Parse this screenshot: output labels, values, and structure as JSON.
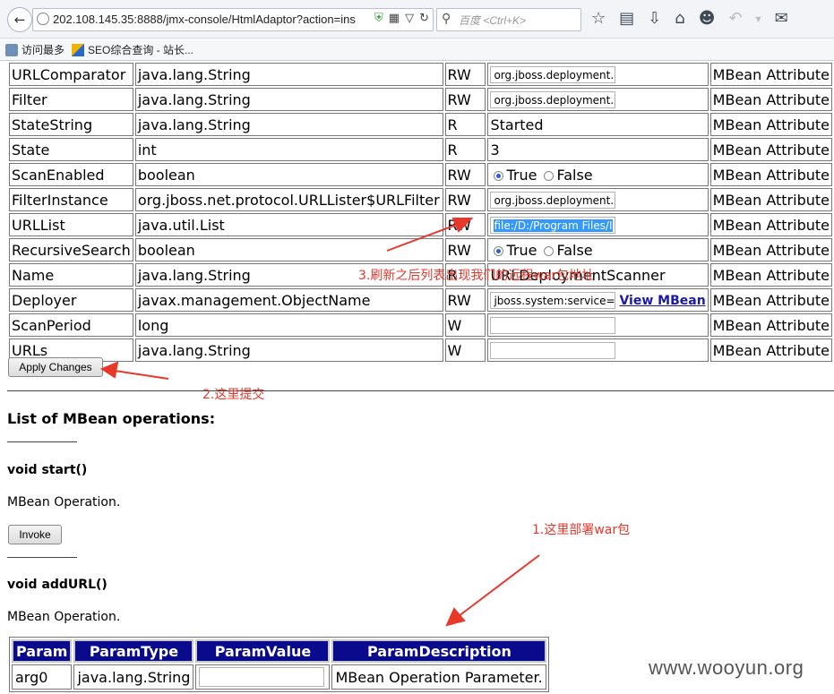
{
  "browser": {
    "url": "202.108.145.35:8888/jmx-console/HtmlAdaptor?action=ins",
    "search_placeholder": "百度 <Ctrl+K>",
    "bookmarks": [
      "访问最多",
      "SEO综合查询 - 站长..."
    ]
  },
  "attributes": [
    {
      "name": "URLComparator",
      "type": "java.lang.String",
      "access": "RW",
      "value_kind": "input",
      "value": "org.jboss.deployment.De",
      "desc": "MBean Attribute"
    },
    {
      "name": "Filter",
      "type": "java.lang.String",
      "access": "RW",
      "value_kind": "input",
      "value": "org.jboss.deployment.sc",
      "desc": "MBean Attribute"
    },
    {
      "name": "StateString",
      "type": "java.lang.String",
      "access": "R",
      "value_kind": "text",
      "value": "Started",
      "desc": "MBean Attribute"
    },
    {
      "name": "State",
      "type": "int",
      "access": "R",
      "value_kind": "text",
      "value": "3",
      "desc": "MBean Attribute"
    },
    {
      "name": "ScanEnabled",
      "type": "boolean",
      "access": "RW",
      "value_kind": "radio",
      "true_label": "True",
      "false_label": "False",
      "selected": "True",
      "desc": "MBean Attribute"
    },
    {
      "name": "FilterInstance",
      "type": "org.jboss.net.protocol.URLLister$URLFilter",
      "access": "RW",
      "value_kind": "input",
      "value": "org.jboss.deployment.sc",
      "desc": "MBean Attribute"
    },
    {
      "name": "URLList",
      "type": "java.util.List",
      "access": "RW",
      "value_kind": "input-selected",
      "value": "file:/D:/Program Files/I",
      "desc": "MBean Attribute"
    },
    {
      "name": "RecursiveSearch",
      "type": "boolean",
      "access": "RW",
      "value_kind": "radio",
      "true_label": "True",
      "false_label": "False",
      "selected": "True",
      "desc": "MBean Attribute"
    },
    {
      "name": "Name",
      "type": "java.lang.String",
      "access": "R",
      "value_kind": "text",
      "value": "URLDeploymentScanner",
      "desc": "MBean Attribute"
    },
    {
      "name": "Deployer",
      "type": "javax.management.ObjectName",
      "access": "RW",
      "value_kind": "input-link",
      "value": "jboss.system:service=M",
      "link": "View MBean",
      "desc": "MBean Attribute"
    },
    {
      "name": "ScanPeriod",
      "type": "long",
      "access": "W",
      "value_kind": "input",
      "value": "",
      "desc": "MBean Attribute"
    },
    {
      "name": "URLs",
      "type": "java.lang.String",
      "access": "W",
      "value_kind": "input",
      "value": "",
      "desc": "MBean Attribute"
    }
  ],
  "apply_button": "Apply Changes",
  "operations_heading": "List of MBean operations:",
  "operations": [
    {
      "signature": "void start()",
      "description": "MBean Operation.",
      "button": "Invoke"
    },
    {
      "signature": "void addURL()",
      "description": "MBean Operation."
    }
  ],
  "params": {
    "headers": [
      "Param",
      "ParamType",
      "ParamValue",
      "ParamDescription"
    ],
    "rows": [
      {
        "param": "arg0",
        "type": "java.lang.String",
        "value": "",
        "description": "MBean Operation Parameter."
      }
    ]
  },
  "annotations": {
    "a1": "1.这里部署war包",
    "a2": "2.这里提交",
    "a3": "3.刷新之后列表出现我们的远程war包地址"
  },
  "watermark": "www.wooyun.org",
  "colors": {
    "annotation": "#e8382c",
    "param_header_bg": "#0a0a8c",
    "link": "#1a1aa6"
  }
}
